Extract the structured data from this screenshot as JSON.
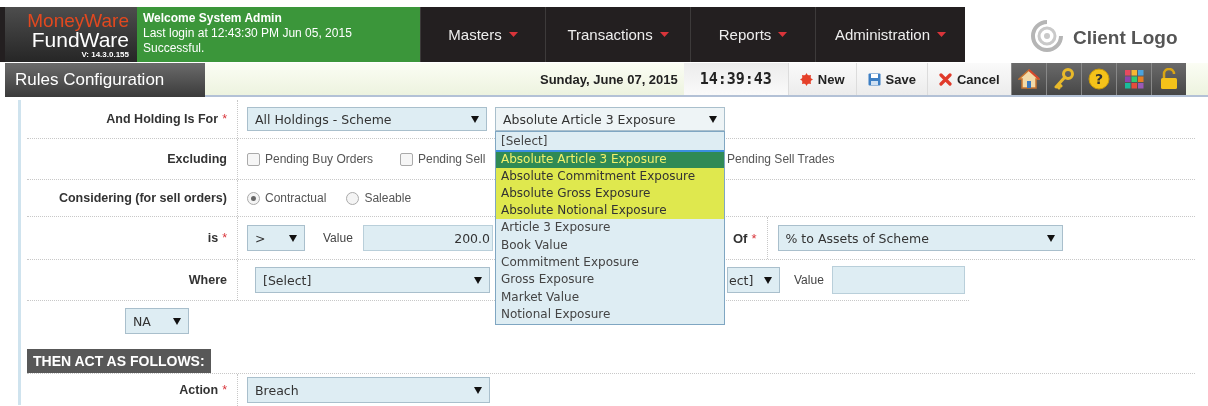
{
  "brand": {
    "top": "MoneyWare",
    "bottom": "FundWare",
    "version": "V: 14.3.0.155"
  },
  "welcome": {
    "title": "Welcome System Admin",
    "last_login": "Last login at 12:43:30 PM Jun 05, 2015",
    "status": "Successful."
  },
  "menu": [
    {
      "label": "Masters"
    },
    {
      "label": "Transactions"
    },
    {
      "label": "Reports"
    },
    {
      "label": "Administration"
    }
  ],
  "client_logo": {
    "label": "Client Logo"
  },
  "page_title": "Rules Configuration",
  "toolbar": {
    "date": "Sunday, June 07, 2015",
    "clock": "14:39:43",
    "buttons": [
      {
        "kind": "new",
        "label": "New"
      },
      {
        "kind": "save",
        "label": "Save"
      },
      {
        "kind": "cancel",
        "label": "Cancel"
      }
    ],
    "icon_buttons": [
      {
        "kind": "home"
      },
      {
        "kind": "keys"
      },
      {
        "kind": "help",
        "glyph": "?"
      },
      {
        "kind": "grid"
      },
      {
        "kind": "lock"
      }
    ]
  },
  "form": {
    "holding": {
      "label": "And Holding Is For",
      "required_mark": "*",
      "scope": "All Holdings - Scheme",
      "measure": "Absolute Article 3 Exposure",
      "options": [
        {
          "label": "[Select]",
          "selected": false,
          "highlighted": false
        },
        {
          "label": "Absolute Article 3 Exposure",
          "selected": true,
          "highlighted": true
        },
        {
          "label": "Absolute Commitment Exposure",
          "selected": false,
          "highlighted": true
        },
        {
          "label": "Absolute Gross Exposure",
          "selected": false,
          "highlighted": true
        },
        {
          "label": "Absolute Notional Exposure",
          "selected": false,
          "highlighted": true
        },
        {
          "label": "Article 3 Exposure",
          "selected": false,
          "highlighted": false
        },
        {
          "label": "Book Value",
          "selected": false,
          "highlighted": false
        },
        {
          "label": "Commitment Exposure",
          "selected": false,
          "highlighted": false
        },
        {
          "label": "Gross Exposure",
          "selected": false,
          "highlighted": false
        },
        {
          "label": "Market Value",
          "selected": false,
          "highlighted": false
        },
        {
          "label": "Notional Exposure",
          "selected": false,
          "highlighted": false
        }
      ]
    },
    "excluding": {
      "label": "Excluding",
      "items": [
        {
          "label": "Pending Buy Orders",
          "checked": false
        },
        {
          "label": "Pending Sell",
          "checked": false
        },
        {
          "label": "Pending Sell Trades"
        }
      ]
    },
    "considering": {
      "label": "Considering (for sell orders)",
      "options": [
        {
          "label": "Contractual",
          "selected": true
        },
        {
          "label": "Saleable",
          "selected": false
        }
      ]
    },
    "condition": {
      "label": "is",
      "required_mark": "*",
      "operator": ">",
      "value_label": "Value",
      "value": "200.0",
      "of_label": "Of",
      "of_required_mark": "*",
      "of_value": "% to Assets of Scheme"
    },
    "where": {
      "label": "Where",
      "field": "[Select]",
      "operator": "ect]",
      "value_label": "Value"
    },
    "join": "NA",
    "section_title": "THEN ACT AS FOLLOWS:",
    "action": {
      "label": "Action",
      "required_mark": "*",
      "value": "Breach"
    }
  }
}
